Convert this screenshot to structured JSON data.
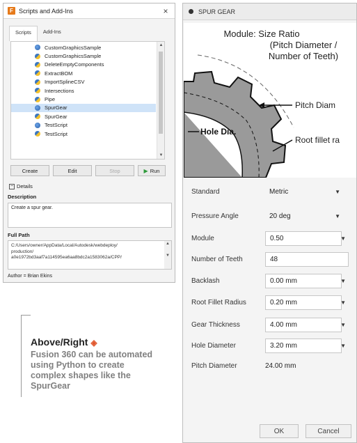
{
  "dialog": {
    "title": "Scripts and Add-Ins",
    "app_icon": "F",
    "close": "×",
    "tabs": [
      "Scripts",
      "Add-Ins"
    ],
    "scripts": [
      {
        "name": "CustomGraphicsSample",
        "icon": "python-blue-icon",
        "selected": false
      },
      {
        "name": "CustomGraphicsSample",
        "icon": "python-icon",
        "selected": false
      },
      {
        "name": "DeleteEmptyComponents",
        "icon": "python-icon",
        "selected": false
      },
      {
        "name": "ExtractBOM",
        "icon": "python-icon",
        "selected": false
      },
      {
        "name": "ImportSplineCSV",
        "icon": "python-icon",
        "selected": false
      },
      {
        "name": "Intersections",
        "icon": "python-icon",
        "selected": false
      },
      {
        "name": "Pipe",
        "icon": "python-icon",
        "selected": false
      },
      {
        "name": "SpurGear",
        "icon": "python-blue-icon",
        "selected": true
      },
      {
        "name": "SpurGear",
        "icon": "python-icon",
        "selected": false
      },
      {
        "name": "TestScript",
        "icon": "python-blue-icon",
        "selected": false
      },
      {
        "name": "TestScript",
        "icon": "python-icon",
        "selected": false
      }
    ],
    "buttons": {
      "create": "Create",
      "edit": "Edit",
      "stop": "Stop",
      "run": "Run"
    },
    "details_toggle": "Details",
    "description_label": "Description",
    "description": "Create a spur gear.",
    "full_path_label": "Full Path",
    "full_path_lines": [
      "C:/Users/owner/AppData/Local/Autodesk/webdeploy/",
      "production/",
      "a0e1972bd3aaf7a114595ea6aa8bdc2a1583062a/CPP/"
    ],
    "author": "Author = Brian Ekins"
  },
  "caption": {
    "title": "Above/Right",
    "text": "Fusion 360 can be automated using Python to create complex shapes like the SpurGear"
  },
  "panel": {
    "title": "SPUR GEAR",
    "diagram": {
      "heading_1": "Module: Size Ratio",
      "heading_2": "(Pitch Diameter /",
      "heading_3": "Number of Teeth)",
      "pitch_label": "Pitch Diam",
      "hole_label": "Hole Dia.",
      "root_label": "Root fillet ra"
    },
    "fields": {
      "standard": {
        "label": "Standard",
        "value": "Metric"
      },
      "pressure_angle": {
        "label": "Pressure Angle",
        "value": "20 deg"
      },
      "module": {
        "label": "Module",
        "value": "0.50"
      },
      "teeth": {
        "label": "Number of Teeth",
        "value": "48"
      },
      "backlash": {
        "label": "Backlash",
        "value": "0.00 mm"
      },
      "root_fillet": {
        "label": "Root Fillet Radius",
        "value": "0.20 mm"
      },
      "thickness": {
        "label": "Gear Thickness",
        "value": "4.00 mm"
      },
      "hole": {
        "label": "Hole Diameter",
        "value": "3.20 mm"
      },
      "pitch": {
        "label": "Pitch Diameter",
        "value": "24.00 mm"
      }
    },
    "ok": "OK",
    "cancel": "Cancel"
  }
}
